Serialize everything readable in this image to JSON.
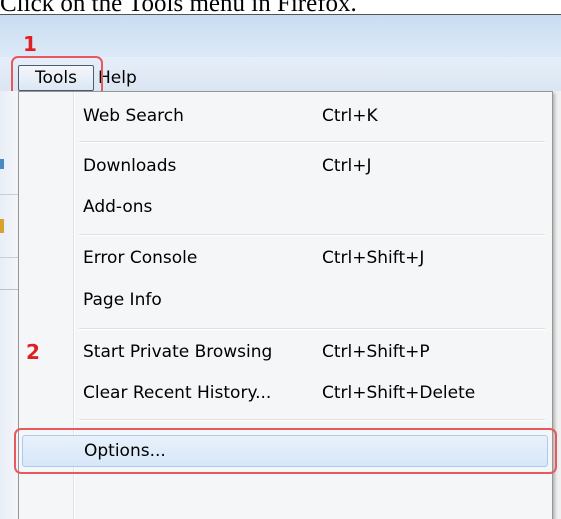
{
  "caption": "Click on the Tools menu in Firefox.",
  "markers": {
    "one": "1",
    "two": "2"
  },
  "menubar": {
    "tools": "Tools",
    "help": "Help"
  },
  "menu": {
    "items": [
      {
        "label": "Web Search",
        "shortcut": "Ctrl+K"
      },
      {
        "label": "Downloads",
        "shortcut": "Ctrl+J"
      },
      {
        "label": "Add-ons",
        "shortcut": ""
      },
      {
        "label": "Error Console",
        "shortcut": "Ctrl+Shift+J"
      },
      {
        "label": "Page Info",
        "shortcut": ""
      },
      {
        "label": "Start Private Browsing",
        "shortcut": "Ctrl+Shift+P"
      },
      {
        "label": "Clear Recent History...",
        "shortcut": "Ctrl+Shift+Delete"
      },
      {
        "label": "Options...",
        "shortcut": ""
      }
    ]
  },
  "colors": {
    "marker": "#e8595d",
    "marker_number": "#e02020",
    "highlight": "#d7e7f8"
  }
}
